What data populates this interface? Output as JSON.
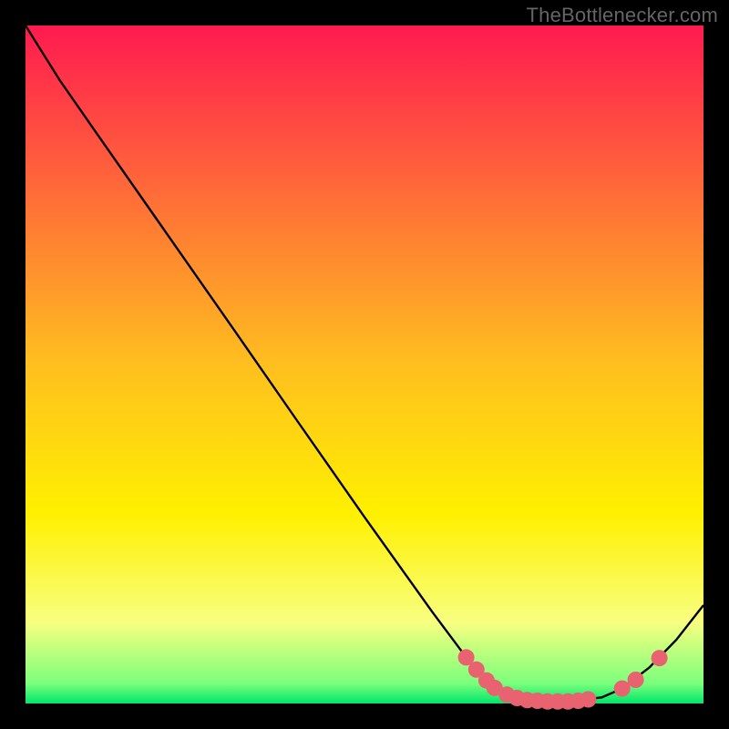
{
  "watermark": "TheBottlenecker.com",
  "chart_data": {
    "type": "line",
    "title": "",
    "xlabel": "",
    "ylabel": "",
    "xlim": [
      0,
      100
    ],
    "ylim": [
      0,
      100
    ],
    "grid": false,
    "background_gradient": {
      "stops": [
        {
          "offset": 0.0,
          "color": "#ff1a50"
        },
        {
          "offset": 0.5,
          "color": "#ffbf1f"
        },
        {
          "offset": 0.72,
          "color": "#fff000"
        },
        {
          "offset": 0.88,
          "color": "#f8ff80"
        },
        {
          "offset": 0.97,
          "color": "#7cff7c"
        },
        {
          "offset": 1.0,
          "color": "#00e66b"
        }
      ]
    },
    "series": [
      {
        "name": "curve",
        "type": "line",
        "color": "#000000",
        "points": [
          {
            "x": 0.0,
            "y": 100.0
          },
          {
            "x": 2.5,
            "y": 96.0
          },
          {
            "x": 5.0,
            "y": 92.0
          },
          {
            "x": 10.0,
            "y": 84.8
          },
          {
            "x": 20.0,
            "y": 70.5
          },
          {
            "x": 30.0,
            "y": 56.2
          },
          {
            "x": 40.0,
            "y": 41.8
          },
          {
            "x": 50.0,
            "y": 27.5
          },
          {
            "x": 60.0,
            "y": 13.5
          },
          {
            "x": 65.0,
            "y": 6.8
          },
          {
            "x": 68.0,
            "y": 3.3
          },
          {
            "x": 71.0,
            "y": 1.3
          },
          {
            "x": 75.0,
            "y": 0.4
          },
          {
            "x": 80.0,
            "y": 0.3
          },
          {
            "x": 85.0,
            "y": 0.9
          },
          {
            "x": 88.0,
            "y": 2.2
          },
          {
            "x": 92.0,
            "y": 5.3
          },
          {
            "x": 96.0,
            "y": 9.4
          },
          {
            "x": 100.0,
            "y": 14.5
          }
        ]
      },
      {
        "name": "markers",
        "type": "scatter",
        "color": "#e86270",
        "radius": 9,
        "points": [
          {
            "x": 65.0,
            "y": 6.8
          },
          {
            "x": 66.5,
            "y": 5.0
          },
          {
            "x": 68.0,
            "y": 3.4
          },
          {
            "x": 69.2,
            "y": 2.3
          },
          {
            "x": 71.0,
            "y": 1.3
          },
          {
            "x": 72.5,
            "y": 0.8
          },
          {
            "x": 74.0,
            "y": 0.5
          },
          {
            "x": 75.5,
            "y": 0.4
          },
          {
            "x": 77.0,
            "y": 0.3
          },
          {
            "x": 78.5,
            "y": 0.3
          },
          {
            "x": 80.0,
            "y": 0.3
          },
          {
            "x": 81.5,
            "y": 0.4
          },
          {
            "x": 83.0,
            "y": 0.6
          },
          {
            "x": 88.0,
            "y": 2.2
          },
          {
            "x": 90.0,
            "y": 3.5
          },
          {
            "x": 93.5,
            "y": 6.7
          }
        ]
      }
    ]
  }
}
